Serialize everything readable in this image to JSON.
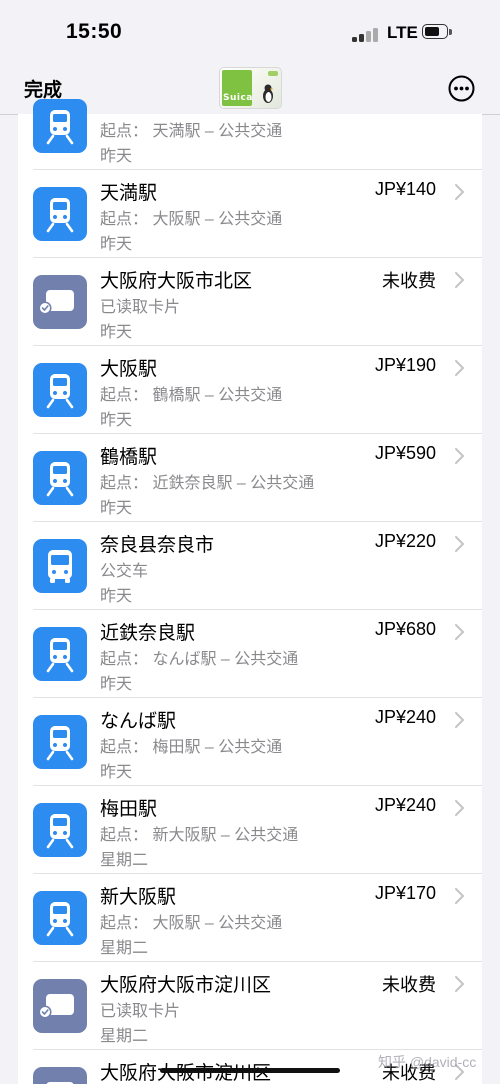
{
  "status_bar": {
    "time": "15:50",
    "network": "LTE",
    "signal_icon": "signal-bars-icon",
    "battery_icon": "battery-icon"
  },
  "nav": {
    "done_label": "完成",
    "card_thumbnail": {
      "name": "Suica",
      "icon": "suica-card-icon"
    },
    "more_icon": "ellipsis-circle-icon"
  },
  "colors": {
    "transit_blue": "#2d8cf0",
    "card_read_slate": "#7180ad",
    "background": "#f2f2f7",
    "secondary_text": "#8a8a8e",
    "suica_green": "#7fc241"
  },
  "transactions": [
    {
      "type": "train",
      "icon": "train-icon",
      "title": "",
      "amount": "",
      "subtitle": "起点： 天満駅 – 公共交通",
      "date": "昨天"
    },
    {
      "type": "train",
      "icon": "train-icon",
      "title": "天満駅",
      "amount": "JP¥140",
      "subtitle": "起点： 大阪駅 – 公共交通",
      "date": "昨天"
    },
    {
      "type": "card",
      "icon": "card-read-icon",
      "title": "大阪府大阪市北区",
      "amount": "未收费",
      "subtitle": "已读取卡片",
      "date": "昨天"
    },
    {
      "type": "train",
      "icon": "train-icon",
      "title": "大阪駅",
      "amount": "JP¥190",
      "subtitle": "起点： 鶴橋駅 – 公共交通",
      "date": "昨天"
    },
    {
      "type": "train",
      "icon": "train-icon",
      "title": "鶴橋駅",
      "amount": "JP¥590",
      "subtitle": "起点： 近鉄奈良駅 – 公共交通",
      "date": "昨天"
    },
    {
      "type": "bus",
      "icon": "bus-icon",
      "title": "奈良县奈良市",
      "amount": "JP¥220",
      "subtitle": "公交车",
      "date": "昨天"
    },
    {
      "type": "train",
      "icon": "train-icon",
      "title": "近鉄奈良駅",
      "amount": "JP¥680",
      "subtitle": "起点： なんば駅 – 公共交通",
      "date": "昨天"
    },
    {
      "type": "train",
      "icon": "train-icon",
      "title": "なんば駅",
      "amount": "JP¥240",
      "subtitle": "起点： 梅田駅 – 公共交通",
      "date": "昨天"
    },
    {
      "type": "train",
      "icon": "train-icon",
      "title": "梅田駅",
      "amount": "JP¥240",
      "subtitle": "起点： 新大阪駅 – 公共交通",
      "date": "星期二"
    },
    {
      "type": "train",
      "icon": "train-icon",
      "title": "新大阪駅",
      "amount": "JP¥170",
      "subtitle": "起点： 大阪駅 – 公共交通",
      "date": "星期二"
    },
    {
      "type": "card",
      "icon": "card-read-icon",
      "title": "大阪府大阪市淀川区",
      "amount": "未收费",
      "subtitle": "已读取卡片",
      "date": "星期二"
    },
    {
      "type": "card",
      "icon": "card-read-icon",
      "title": "大阪府大阪市淀川区",
      "amount": "未收费",
      "subtitle": "",
      "date": ""
    }
  ],
  "watermark": "知乎 @david-cc"
}
